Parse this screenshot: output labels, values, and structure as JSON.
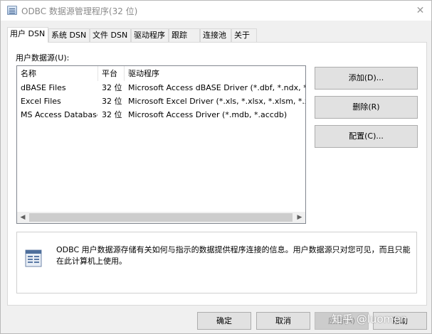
{
  "window": {
    "title": "ODBC 数据源管理程序(32 位)",
    "close_glyph": "✕"
  },
  "tabs": [
    {
      "label": "用户 DSN",
      "active": true
    },
    {
      "label": "系统 DSN"
    },
    {
      "label": "文件 DSN"
    },
    {
      "label": "驱动程序"
    },
    {
      "label": "跟踪"
    },
    {
      "label": "连接池"
    },
    {
      "label": "关于"
    }
  ],
  "datasources": {
    "label": "用户数据源(U):",
    "columns": [
      "名称",
      "平台",
      "驱动程序"
    ],
    "rows": [
      {
        "name": "dBASE Files",
        "platform": "32 位",
        "driver": "Microsoft Access dBASE Driver (*.dbf, *.ndx, *.mdx)"
      },
      {
        "name": "Excel Files",
        "platform": "32 位",
        "driver": "Microsoft Excel Driver (*.xls, *.xlsx, *.xlsm, *.xlsb)"
      },
      {
        "name": "MS Access Database",
        "platform": "32 位",
        "driver": "Microsoft Access Driver (*.mdb, *.accdb)"
      }
    ],
    "scroll_left": "◀",
    "scroll_right": "▶"
  },
  "side_buttons": {
    "add": "添加(D)...",
    "remove": "删除(R)",
    "configure": "配置(C)..."
  },
  "info": {
    "icon": "datasource-icon",
    "text": "ODBC 用户数据源存储有关如何与指示的数据提供程序连接的信息。用户数据源只对您可见，而且只能在此计算机上使用。"
  },
  "bottom_buttons": {
    "ok": "确定",
    "cancel": "取消",
    "apply": "应用(A)",
    "help": "帮助"
  },
  "watermark": "知乎 @luomen",
  "colors": {
    "accent_selected_row": "#cce8ff",
    "window_bg": "#f0f0f0",
    "panel_bg": "#ffffff"
  }
}
